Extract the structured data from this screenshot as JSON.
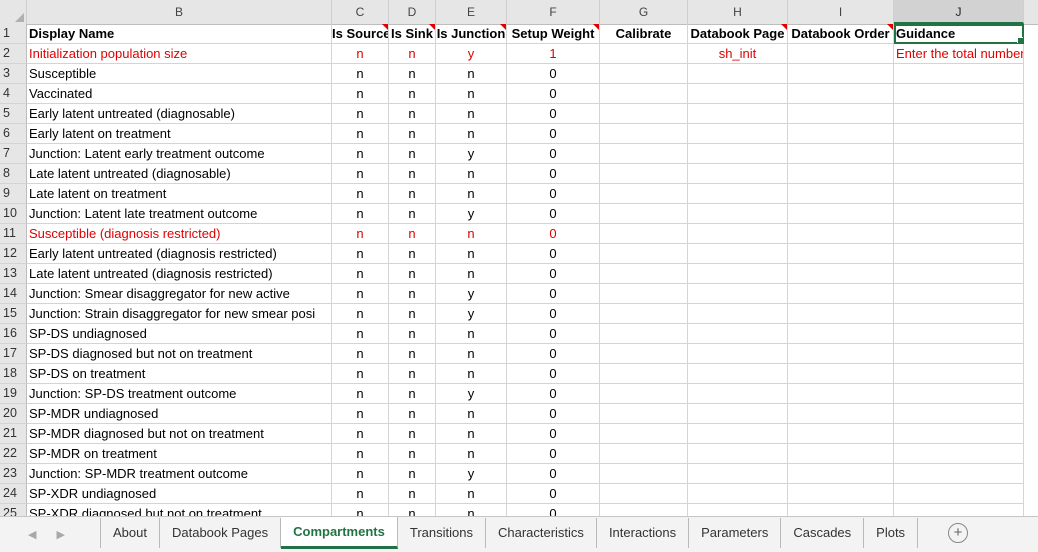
{
  "column_letters": [
    "B",
    "C",
    "D",
    "E",
    "F",
    "G",
    "H",
    "I",
    "J"
  ],
  "selected_column": "J",
  "header_row": {
    "number": "1",
    "cells": [
      "Display Name",
      "Is Source",
      "Is Sink",
      "Is Junction",
      "Setup Weight",
      "Calibrate",
      "Databook Page",
      "Databook Order",
      "Guidance"
    ]
  },
  "rows": [
    {
      "n": "2",
      "name": "Initialization population size",
      "src": "n",
      "sink": "n",
      "junc": "y",
      "weight": "1",
      "page": "sh_init",
      "guidance": "Enter the total number",
      "red": true
    },
    {
      "n": "3",
      "name": "Susceptible",
      "src": "n",
      "sink": "n",
      "junc": "n",
      "weight": "0"
    },
    {
      "n": "4",
      "name": "Vaccinated",
      "src": "n",
      "sink": "n",
      "junc": "n",
      "weight": "0"
    },
    {
      "n": "5",
      "name": "Early latent untreated (diagnosable)",
      "src": "n",
      "sink": "n",
      "junc": "n",
      "weight": "0"
    },
    {
      "n": "6",
      "name": "Early latent on treatment",
      "src": "n",
      "sink": "n",
      "junc": "n",
      "weight": "0"
    },
    {
      "n": "7",
      "name": "Junction: Latent early treatment outcome",
      "src": "n",
      "sink": "n",
      "junc": "y",
      "weight": "0"
    },
    {
      "n": "8",
      "name": "Late latent untreated (diagnosable)",
      "src": "n",
      "sink": "n",
      "junc": "n",
      "weight": "0"
    },
    {
      "n": "9",
      "name": "Late latent on treatment",
      "src": "n",
      "sink": "n",
      "junc": "n",
      "weight": "0"
    },
    {
      "n": "10",
      "name": "Junction: Latent late treatment outcome",
      "src": "n",
      "sink": "n",
      "junc": "y",
      "weight": "0"
    },
    {
      "n": "11",
      "name": "Susceptible (diagnosis restricted)",
      "src": "n",
      "sink": "n",
      "junc": "n",
      "weight": "0",
      "red": true
    },
    {
      "n": "12",
      "name": "Early latent untreated (diagnosis restricted)",
      "src": "n",
      "sink": "n",
      "junc": "n",
      "weight": "0"
    },
    {
      "n": "13",
      "name": "Late latent untreated (diagnosis restricted)",
      "src": "n",
      "sink": "n",
      "junc": "n",
      "weight": "0"
    },
    {
      "n": "14",
      "name": "Junction: Smear disaggregator for new active",
      "src": "n",
      "sink": "n",
      "junc": "y",
      "weight": "0"
    },
    {
      "n": "15",
      "name": "Junction: Strain disaggregator for new smear posi",
      "src": "n",
      "sink": "n",
      "junc": "y",
      "weight": "0"
    },
    {
      "n": "16",
      "name": "SP-DS undiagnosed",
      "src": "n",
      "sink": "n",
      "junc": "n",
      "weight": "0"
    },
    {
      "n": "17",
      "name": "SP-DS diagnosed but not on treatment",
      "src": "n",
      "sink": "n",
      "junc": "n",
      "weight": "0"
    },
    {
      "n": "18",
      "name": "SP-DS on treatment",
      "src": "n",
      "sink": "n",
      "junc": "n",
      "weight": "0"
    },
    {
      "n": "19",
      "name": "Junction: SP-DS treatment outcome",
      "src": "n",
      "sink": "n",
      "junc": "y",
      "weight": "0"
    },
    {
      "n": "20",
      "name": "SP-MDR undiagnosed",
      "src": "n",
      "sink": "n",
      "junc": "n",
      "weight": "0"
    },
    {
      "n": "21",
      "name": "SP-MDR diagnosed but not on treatment",
      "src": "n",
      "sink": "n",
      "junc": "n",
      "weight": "0"
    },
    {
      "n": "22",
      "name": "SP-MDR on treatment",
      "src": "n",
      "sink": "n",
      "junc": "n",
      "weight": "0"
    },
    {
      "n": "23",
      "name": "Junction: SP-MDR treatment outcome",
      "src": "n",
      "sink": "n",
      "junc": "y",
      "weight": "0"
    },
    {
      "n": "24",
      "name": "SP-XDR undiagnosed",
      "src": "n",
      "sink": "n",
      "junc": "n",
      "weight": "0"
    },
    {
      "n": "25",
      "name": "SP-XDR diagnosed but not on treatment",
      "src": "n",
      "sink": "n",
      "junc": "n",
      "weight": "0"
    }
  ],
  "sheet_tabs": [
    "About",
    "Databook Pages",
    "Compartments",
    "Transitions",
    "Characteristics",
    "Interactions",
    "Parameters",
    "Cascades",
    "Plots"
  ],
  "active_tab": "Compartments",
  "colors": {
    "accent": "#217346",
    "red_text": "#e00000"
  }
}
